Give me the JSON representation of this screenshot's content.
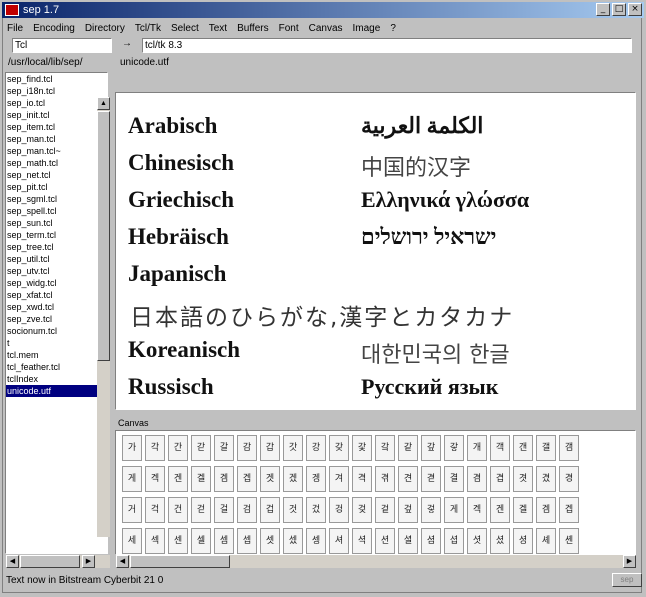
{
  "window": {
    "title": "sep 1.7"
  },
  "menu": [
    "File",
    "Encoding",
    "Directory",
    "Tcl/Tk",
    "Select",
    "Text",
    "Buffers",
    "Font",
    "Canvas",
    "Image",
    "?"
  ],
  "command": {
    "left_value": "Tcl",
    "arrow": "→",
    "right_value": "tcl/tk 8.3"
  },
  "path": {
    "directory": "/usr/local/lib/sep/",
    "file": "unicode.utf"
  },
  "files": [
    "sep_find.tcl",
    "sep_i18n.tcl",
    "sep_io.tcl",
    "sep_init.tcl",
    "sep_item.tcl",
    "sep_man.tcl",
    "sep_man.tcl~",
    "sep_math.tcl",
    "sep_net.tcl",
    "sep_pit.tcl",
    "sep_sgml.tcl",
    "sep_spell.tcl",
    "sep_sun.tcl",
    "sep_term.tcl",
    "sep_tree.tcl",
    "sep_util.tcl",
    "sep_utv.tcl",
    "sep_widg.tcl",
    "sep_xfat.tcl",
    "sep_xwd.tcl",
    "sep_zve.tcl",
    "socionum.tcl",
    "t",
    "tcl.mem",
    "tcl_feather.tcl",
    "tclIndex",
    "unicode.utf"
  ],
  "selected_file": "unicode.utf",
  "languages": [
    {
      "label": "Arabisch",
      "native": "الكلمة العربية"
    },
    {
      "label": "Chinesisch",
      "native": "中国的汉字"
    },
    {
      "label": "Griechisch",
      "native": "Ελληνικά γλώσσα"
    },
    {
      "label": "Hebräisch",
      "native": "ישראיל ירושלים"
    },
    {
      "label": "Japanisch",
      "native": ""
    },
    {
      "label": "Koreanisch",
      "native": "대한민국의 한글"
    },
    {
      "label": "Russisch",
      "native": "Русский язык"
    }
  ],
  "japanese_line": "日本語のひらがな,漢字とカタカナ",
  "canvas": {
    "label": "Canvas",
    "rows": [
      [
        "가",
        "각",
        "간",
        "갇",
        "갈",
        "감",
        "갑",
        "갓",
        "강",
        "갖",
        "갗",
        "갘",
        "같",
        "갚",
        "갛",
        "개",
        "객",
        "갠",
        "갤",
        "갬"
      ],
      [
        "게",
        "겍",
        "겐",
        "겔",
        "겜",
        "겝",
        "겟",
        "겠",
        "겡",
        "겨",
        "격",
        "겪",
        "견",
        "겯",
        "결",
        "겸",
        "겹",
        "겻",
        "겼",
        "경"
      ],
      [
        "거",
        "걱",
        "건",
        "걷",
        "걸",
        "검",
        "겁",
        "것",
        "겄",
        "겅",
        "겆",
        "겉",
        "겊",
        "겋",
        "게",
        "겍",
        "겐",
        "겔",
        "겜",
        "겝"
      ],
      [
        "세",
        "섹",
        "센",
        "셀",
        "셈",
        "셉",
        "셋",
        "셌",
        "셍",
        "셔",
        "셕",
        "션",
        "셜",
        "셤",
        "셥",
        "셧",
        "셨",
        "셩",
        "셰",
        "셴"
      ]
    ]
  },
  "status": {
    "text": "Text now in Bitstream Cyberbit 21 0",
    "button_label": "sep"
  }
}
